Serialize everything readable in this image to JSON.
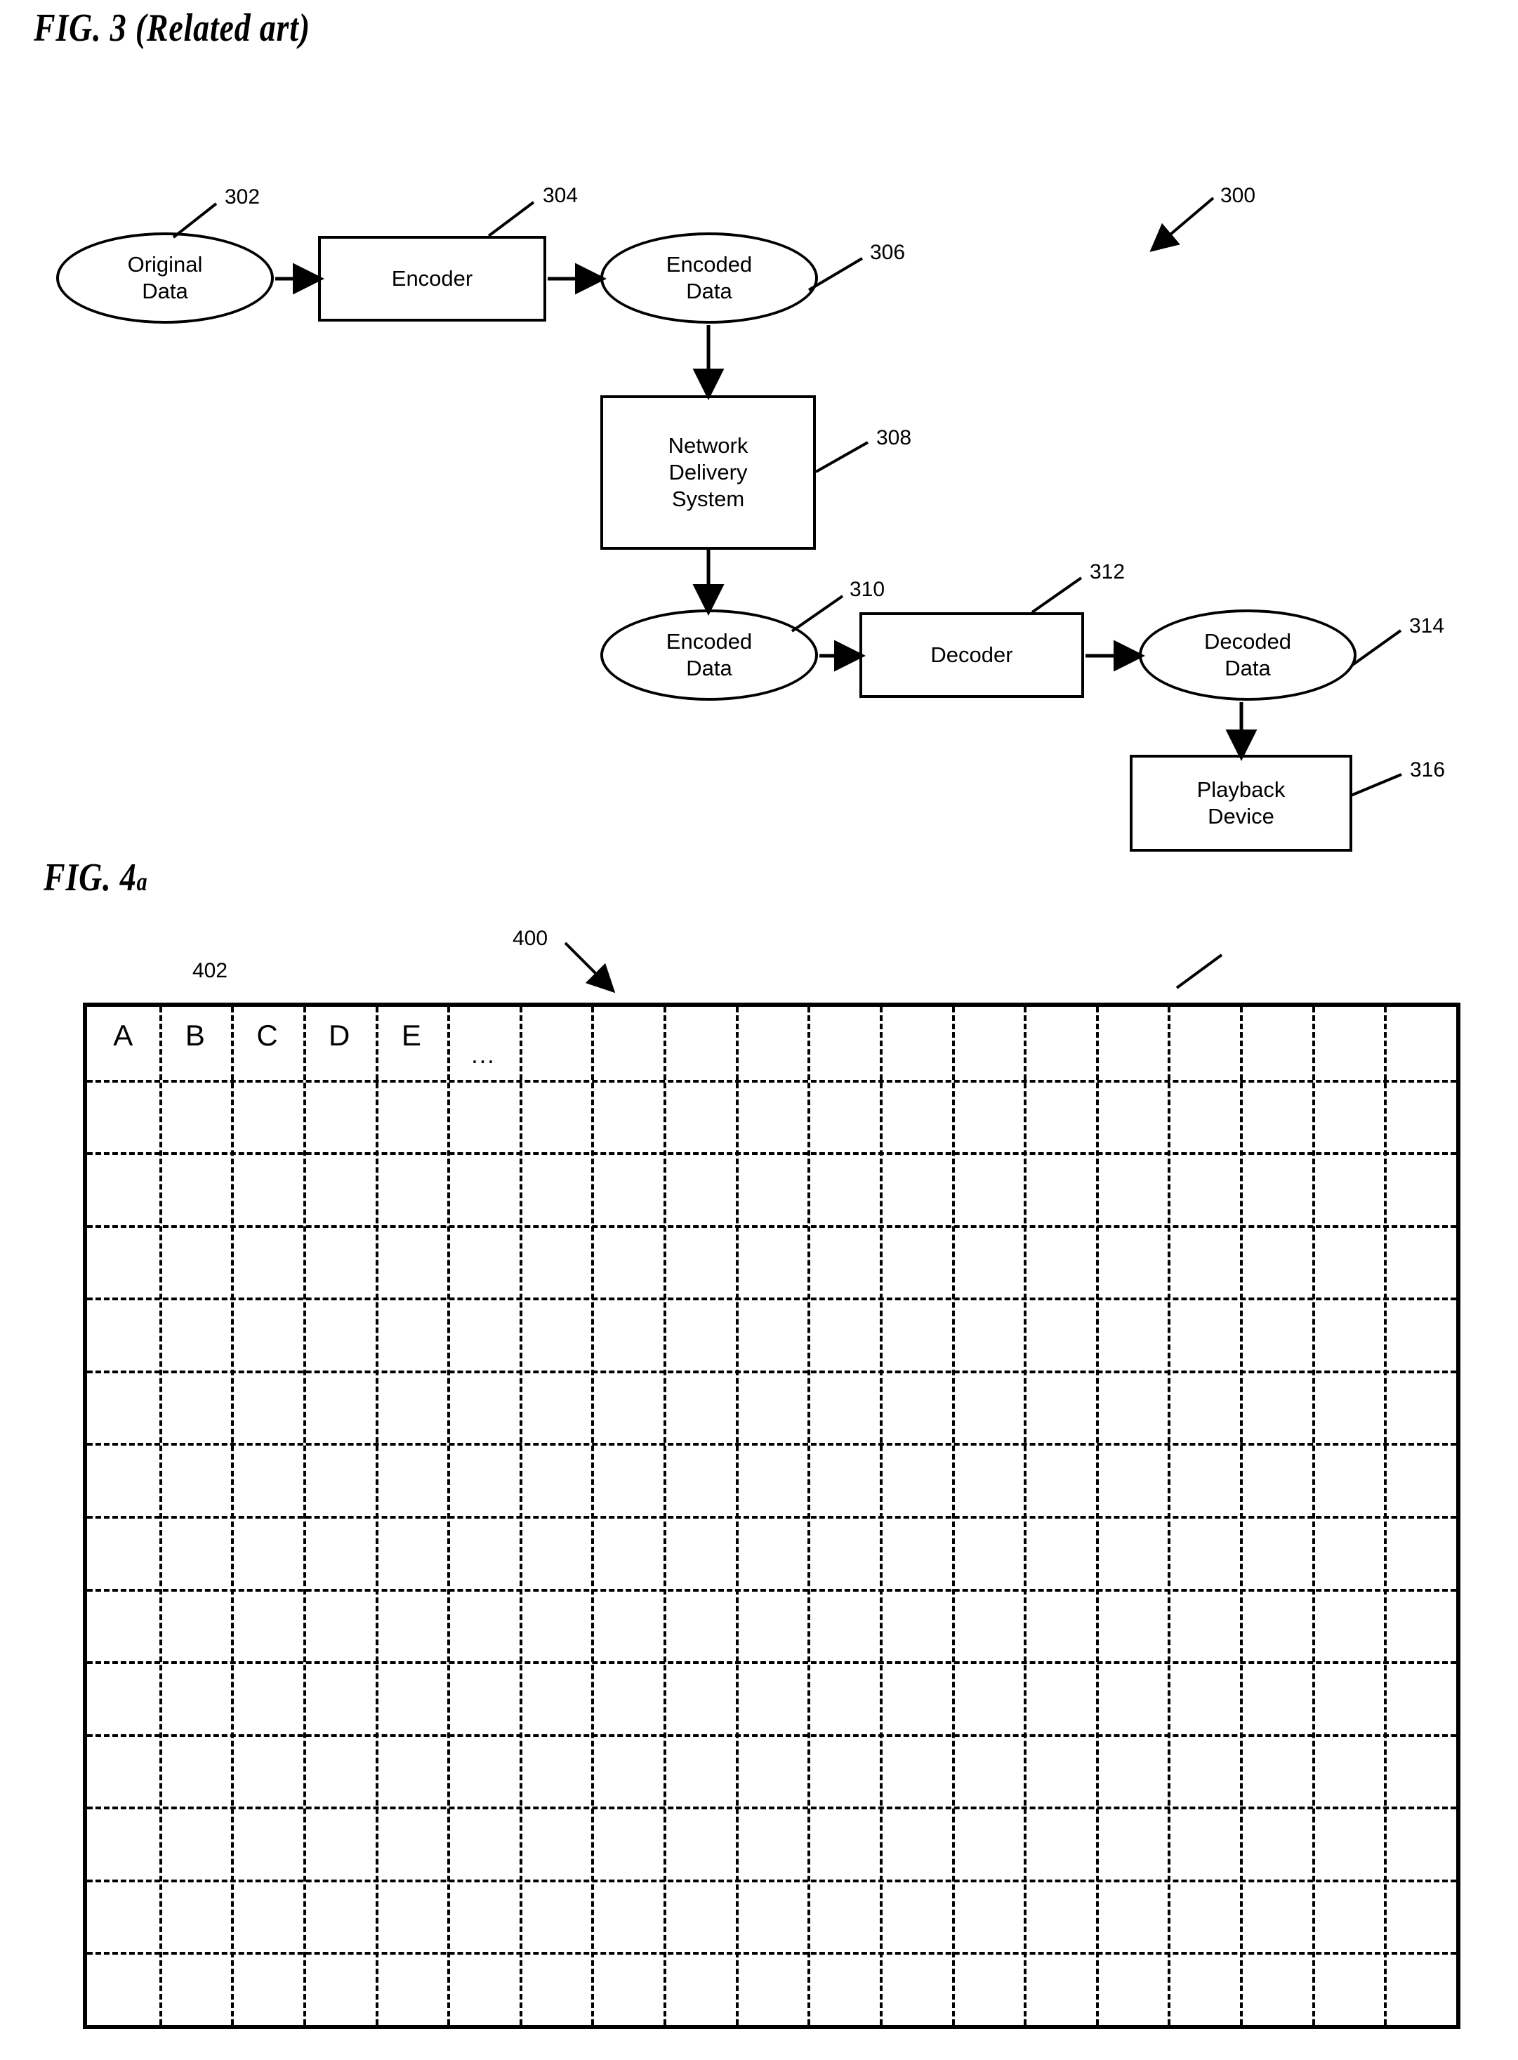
{
  "figures": {
    "fig3": {
      "title_main": "FIG. 3 (Related art)",
      "system_ref": "300",
      "nodes": [
        {
          "id": "original-data",
          "label": "Original\nData",
          "ref": "302",
          "shape": "ellipse"
        },
        {
          "id": "encoder",
          "label": "Encoder",
          "ref": "304",
          "shape": "box"
        },
        {
          "id": "encoded-data-1",
          "label": "Encoded\nData",
          "ref": "306",
          "shape": "ellipse"
        },
        {
          "id": "network-delivery-system",
          "label": "Network\nDelivery\nSystem",
          "ref": "308",
          "shape": "box"
        },
        {
          "id": "encoded-data-2",
          "label": "Encoded\nData",
          "ref": "310",
          "shape": "ellipse"
        },
        {
          "id": "decoder",
          "label": "Decoder",
          "ref": "312",
          "shape": "box"
        },
        {
          "id": "decoded-data",
          "label": "Decoded\nData",
          "ref": "314",
          "shape": "ellipse"
        },
        {
          "id": "playback-device",
          "label": "Playback\nDevice",
          "ref": "316",
          "shape": "box"
        }
      ]
    },
    "fig4a": {
      "title_main": "FIG. 4",
      "title_sub": "a",
      "grid_ref": "400",
      "cell_ref": "402",
      "column_headers": [
        "A",
        "B",
        "C",
        "D",
        "E",
        "..."
      ],
      "grid": {
        "columns": 19,
        "rows": 14
      }
    }
  },
  "colors": {
    "ink": "#000000",
    "paper": "#ffffff"
  }
}
